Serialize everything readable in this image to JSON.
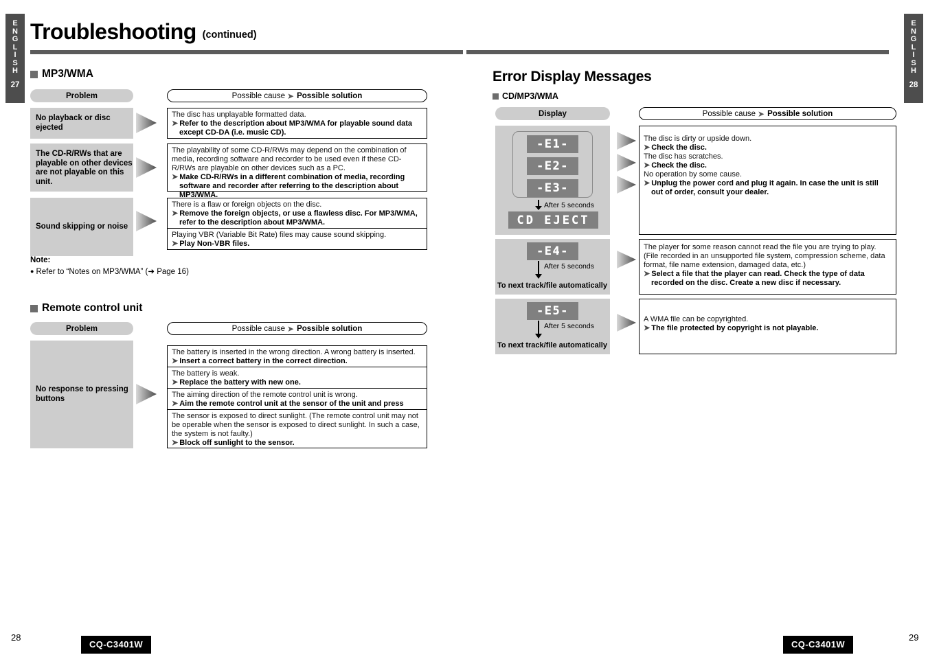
{
  "document": {
    "title": "Troubleshooting",
    "title_suffix": "(continued)",
    "model": "CQ-C3401W"
  },
  "left_page": {
    "side_tab": {
      "language": "ENGLISH",
      "number": "27"
    },
    "page_number": "28",
    "model_badge": "CQ-C3401W",
    "section_mp3": {
      "heading": "MP3/WMA",
      "col_problem": "Problem",
      "col_cause_plain": "Possible cause",
      "col_cause_bold": "Possible solution",
      "rows": [
        {
          "problem": "No playback or disc ejected",
          "answers": [
            {
              "cause": "The disc has unplayable formatted data.",
              "solution": "Refer to the description about MP3/WMA for playable sound data except CD-DA (i.e. music CD)."
            }
          ]
        },
        {
          "problem": "The CD-R/RWs that are playable on other devices are not playable on this unit.",
          "answers": [
            {
              "cause": "The playability of some CD-R/RWs may depend on the combination of media, recording software and recorder to be used even if these CD-R/RWs are playable on other devices such as a PC.",
              "solution": "Make CD-R/RWs in a different combination of media, recording software and recorder after referring to the description about MP3/WMA."
            }
          ]
        },
        {
          "problem": "Sound skipping or noise",
          "answers": [
            {
              "cause": "There is a flaw or foreign objects on the disc.",
              "solution": "Remove the foreign objects, or use a flawless disc. For MP3/WMA, refer to the description about MP3/WMA."
            },
            {
              "cause": "Playing VBR (Variable Bit Rate) files may cause sound skipping.",
              "solution": "Play Non-VBR files."
            }
          ]
        }
      ],
      "note_title": "Note:",
      "note_body": "Refer to “Notes on MP3/WMA” (➜ Page 16)"
    },
    "section_remote": {
      "heading": "Remote control unit",
      "col_problem": "Problem",
      "col_cause_plain": "Possible cause",
      "col_cause_bold": "Possible solution",
      "rows": [
        {
          "problem": "No response to pressing buttons",
          "answers": [
            {
              "cause": "The battery is inserted in the wrong direction. A wrong battery is inserted.",
              "solution": "Insert a correct battery in the correct direction."
            },
            {
              "cause": "The battery is weak.",
              "solution": "Replace the battery with new one."
            },
            {
              "cause": "The aiming direction of the remote control unit is wrong.",
              "solution": "Aim the remote control unit at the sensor of the unit and press buttons."
            },
            {
              "cause": "The sensor is exposed to direct sunlight. (The remote control unit may not be operable when the sensor is exposed to direct sunlight. In such a case, the system is not faulty.)",
              "solution": "Block off sunlight to the sensor."
            }
          ]
        }
      ]
    }
  },
  "right_page": {
    "side_tab": {
      "language": "ENGLISH",
      "number": "28"
    },
    "page_number": "29",
    "model_badge": "CQ-C3401W",
    "heading": "Error Display Messages",
    "subheading": "CD/MP3/WMA",
    "col_display": "Display",
    "col_cause_plain": "Possible cause",
    "col_cause_bold": "Possible solution",
    "after_label": "After 5 seconds",
    "auto_label": "To next track/file automatically",
    "group1": {
      "codes": [
        "-E1-",
        "-E2-",
        "-E3-"
      ],
      "after_display": "CD EJECT",
      "answers": [
        {
          "cause": "The disc is dirty or upside down.",
          "solution": "Check the disc."
        },
        {
          "cause": "The disc has scratches.",
          "solution": "Check the disc."
        },
        {
          "cause": "No operation by some cause.",
          "solution": "Unplug the power cord and plug it again. In case the unit is still out of order, consult your dealer."
        }
      ]
    },
    "group2": {
      "code": "-E4-",
      "answers": [
        {
          "cause": "The player for some reason cannot read the file you are trying to play. (File recorded in an unsupported file system, compression scheme, data format, file name extension, damaged data, etc.)",
          "solution": "Select a file that the player can read. Check the type of data recorded on the disc. Create a new disc if necessary."
        }
      ]
    },
    "group3": {
      "code": "-E5-",
      "answers": [
        {
          "cause": "A WMA file can be copyrighted.",
          "solution": "The file protected by copyright is not playable."
        }
      ]
    }
  },
  "colors": {
    "rule": "#5b5b5b",
    "gray_cell": "#cdcdcd",
    "lcd_bg": "#808080",
    "tab_bg": "#4d4d4d"
  }
}
